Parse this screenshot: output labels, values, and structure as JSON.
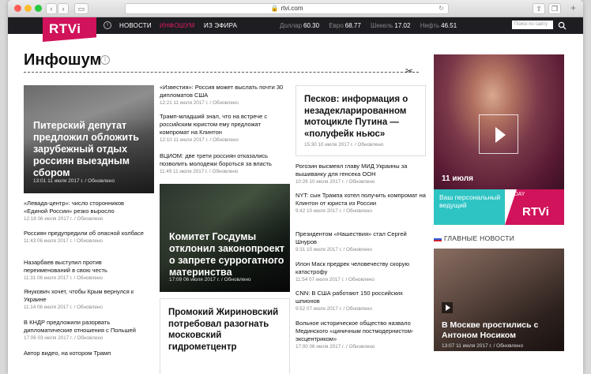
{
  "browser": {
    "url": "rtvi.com"
  },
  "nav": {
    "logo": "RTVi",
    "items": [
      "НОВОСТИ",
      "ИНФОШУМ",
      "ИЗ ЭФИРА"
    ],
    "rates": [
      {
        "label": "Доллар",
        "value": "60.30"
      },
      {
        "label": "Евро",
        "value": "68.77"
      },
      {
        "label": "Шекель",
        "value": "17.02"
      },
      {
        "label": "Нефть",
        "value": "46.51"
      }
    ],
    "search_placeholder": "Поиск по сайту"
  },
  "page": {
    "title": "Инфошум"
  },
  "features": {
    "left": {
      "title": "Питерский депутат предложил обложить зарубежный отдых россиян выездным сбором",
      "meta": "13:01 11 июля 2017 г. / Обновлено"
    },
    "middle": {
      "title": "Комитет Госдумы отклонил законопроект о запрете суррогатного материнства",
      "meta": "17:09 06 июля 2017 г. / Обновлено"
    },
    "side": {
      "title": "В Москве простились с Антоном Носиком",
      "meta": "13:07 11 июля 2017 г. / Обновлено"
    }
  },
  "col1_news": [
    {
      "title": "«Левада-центр»: число сторонников «Единой России» резко выросло",
      "meta": "12:18 06 июля 2017 г. / Обновлено"
    },
    {
      "title": "Россиян предупредили об опасной колбасе",
      "meta": "11:43 06 июля 2017 г. / Обновлено"
    },
    {
      "title": "Назарбаев выступил против переименований в свою честь",
      "meta": "11:31 06 июля 2017 г. / Обновлено"
    },
    {
      "title": "Янукович хочет, чтобы Крым вернулся к Украине",
      "meta": "11:14 06 июля 2017 г. / Обновлено"
    },
    {
      "title": "В КНДР предложили разорвать дипломатические отношения с Польшей",
      "meta": "17:06 03 июля 2017 г. / Обновлено"
    },
    {
      "title": "Автор видео, на котором Трамп",
      "meta": ""
    }
  ],
  "col2_news": [
    {
      "title": "«Известия»: Россия может выслать почти 30 дипломатов США",
      "meta": "12:21 11 июля 2017 г. / Обновлено"
    },
    {
      "title": "Трамп-младший знал, что на встрече с российским юристом ему предложат компромат на Клинтон",
      "meta": "12:10 11 июля 2017 г. / Обновлено"
    },
    {
      "title": "ВЦИОМ: две трети россиян отказались позволить молодежи бороться за власть",
      "meta": "11:49 11 июля 2017 г. / Обновлено"
    }
  ],
  "col2_card": {
    "title": "Промокий Жириновский потребовал разогнать московский гидрометцентр"
  },
  "col3_card": {
    "title": "Песков: информация о незадекларированном мотоцикле Путина — «полуфейк ньюс»",
    "meta": "15:30 10 июля 2017 г. / Обновлено"
  },
  "col3_news": [
    {
      "title": "Рогозин высмеял главу МИД Украины за вышиванку для генсека ООН",
      "meta": "10:26 10 июля 2017 г. / Обновлено"
    },
    {
      "title": "NYT: сын Трампа хотел получить компромат на Клинтон от юриста из России",
      "meta": "9:42 10 июля 2017 г. / Обновлено"
    },
    {
      "title": "Президентом «Нашествия» стал Сергей Шнуров",
      "meta": "9:31 10 июля 2017 г. / Обновлено"
    },
    {
      "title": "Илон Маск предрек человечеству скорую катастрофу",
      "meta": "11:54 07 июля 2017 г. / Обновлено"
    },
    {
      "title": "CNN: В США работают 150 российских шпионов",
      "meta": "9:52 07 июля 2017 г. / Обновлено"
    },
    {
      "title": "Вольное историческое общество назвало Мединского «циничным постмодернистом-эксцентриком»",
      "meta": "17:00 06 июля 2017 г. / Обновлено"
    }
  ],
  "sidebar": {
    "video_date": "11 июля",
    "promo_text": "Ваш персональный ведущий",
    "promo_tag": "TODAY",
    "promo_logo": "RTVi",
    "main_news_header": "ГЛАВНЫЕ НОВОСТИ"
  },
  "colors": {
    "brand": "#d0135a",
    "nav_bg": "#1d1d22",
    "teal": "#2ec4c4"
  }
}
